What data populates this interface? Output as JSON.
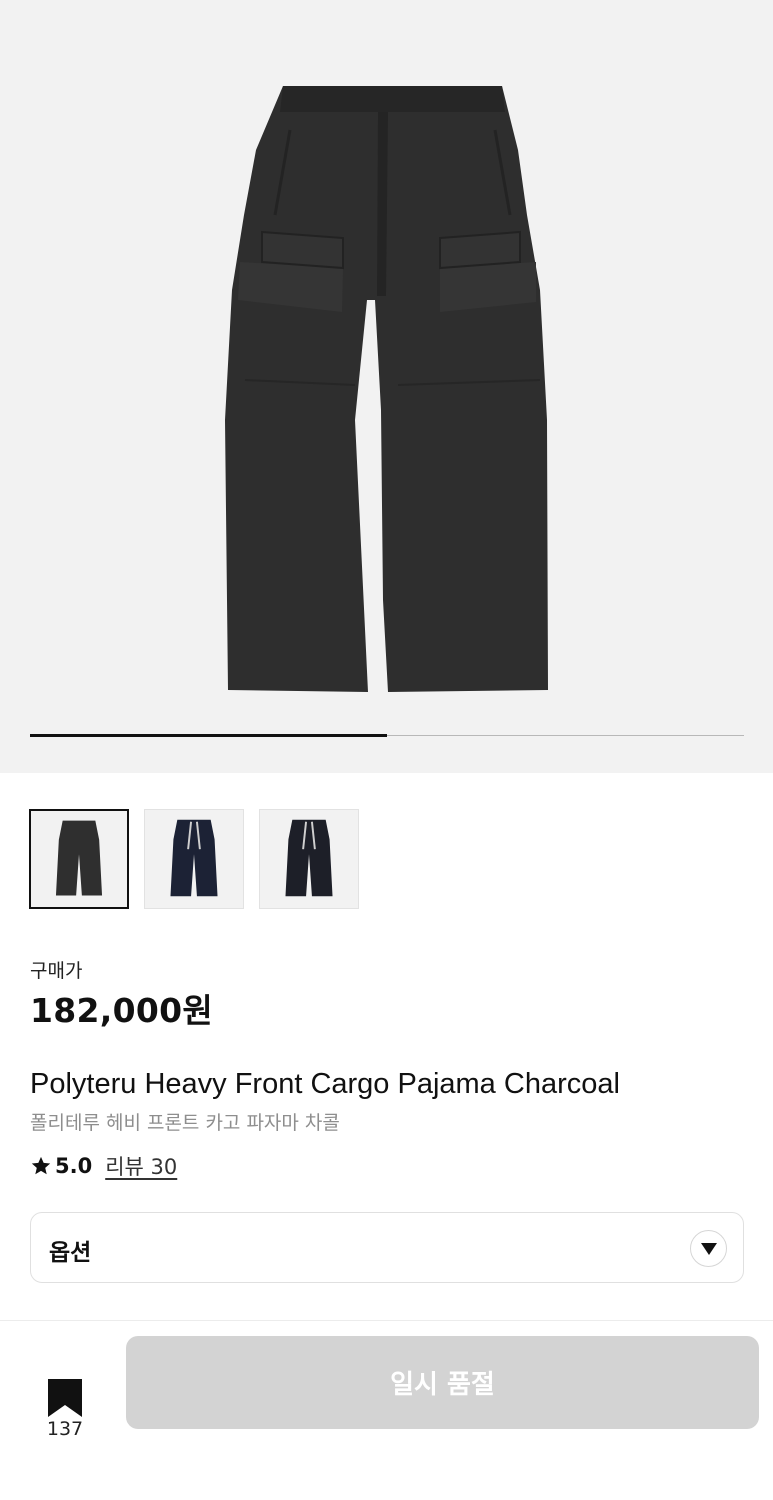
{
  "gallery": {
    "hero_alt": "charcoal-cargo-pants",
    "slide_progress": 0.5,
    "thumbnails": [
      {
        "color": "#2f2f2f",
        "selected": true
      },
      {
        "color": "#1c2235",
        "selected": false
      },
      {
        "color": "#1d1f28",
        "selected": false
      }
    ]
  },
  "product": {
    "price_label": "구매가",
    "price": "182,000원",
    "title_en": "Polyteru Heavy Front Cargo Pajama Charcoal",
    "title_ko": "폴리테루 헤비 프론트 카고 파자마 차콜",
    "rating": "5.0",
    "reviews": "리뷰 30"
  },
  "options": {
    "label": "옵션"
  },
  "bottom_bar": {
    "bookmark_count": "137",
    "button_label": "일시 품절"
  },
  "colors": {
    "disabled_button": "#d3d3d3",
    "gallery_bg": "#f2f2f2"
  }
}
